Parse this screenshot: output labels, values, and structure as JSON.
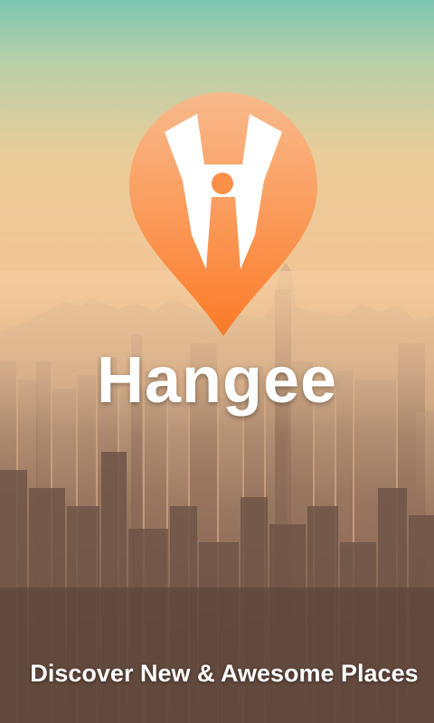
{
  "splash": {
    "app_name": "Hangee",
    "tagline": "Discover New & Awesome Places",
    "logo_icon": "map-pin-h-icon",
    "background": "city-skyline-image"
  },
  "colors": {
    "pin_top": "#fbb88a",
    "pin_bottom": "#fb7a26",
    "text": "#ffffff"
  }
}
